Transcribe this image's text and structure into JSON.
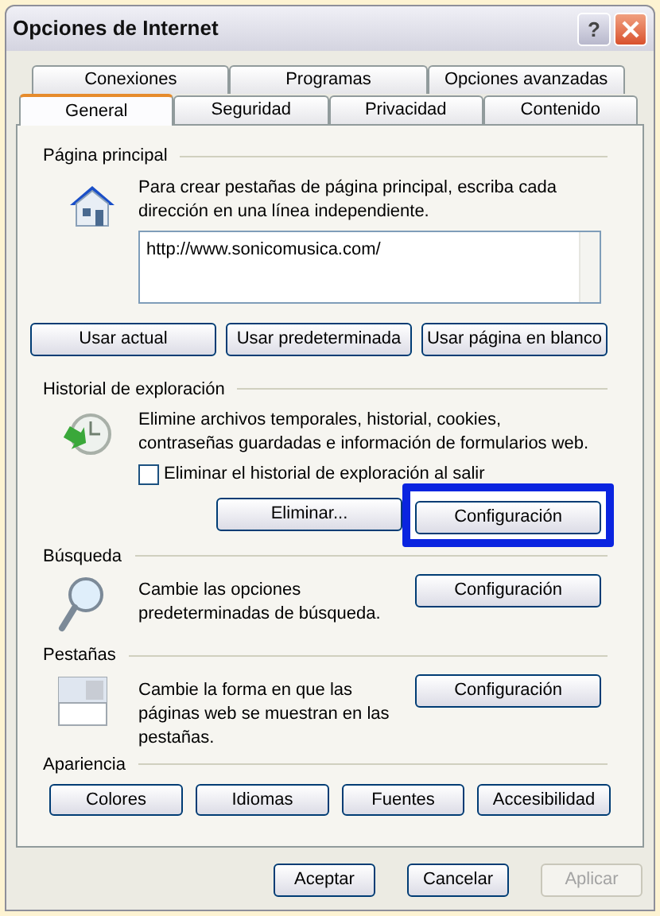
{
  "window": {
    "title": "Opciones de Internet",
    "help": "?"
  },
  "tab_rows": [
    [
      {
        "label": "Conexiones",
        "selected": false
      },
      {
        "label": "Programas",
        "selected": false
      },
      {
        "label": "Opciones avanzadas",
        "selected": false
      }
    ],
    [
      {
        "label": "General",
        "selected": true
      },
      {
        "label": "Seguridad",
        "selected": false
      },
      {
        "label": "Privacidad",
        "selected": false
      },
      {
        "label": "Contenido",
        "selected": false
      }
    ]
  ],
  "sections": [
    {
      "kind": "home",
      "title": "Página principal",
      "description": "Para crear pestañas de página principal, escriba cada dirección en una línea independiente.",
      "url": "http://www.sonicomusica.com/",
      "buttons": [
        {
          "label": "Usar actual",
          "highlighted": false
        },
        {
          "label": "Usar predeterminada",
          "highlighted": false
        },
        {
          "label": "Usar página en blanco",
          "highlighted": false
        }
      ]
    },
    {
      "kind": "history",
      "title": "Historial de exploración",
      "description": "Elimine archivos temporales, historial, cookies, contraseñas guardadas e información de formularios web.",
      "checkbox": {
        "label": "Eliminar el historial de exploración al salir",
        "checked": false
      },
      "buttons": [
        {
          "label": "Eliminar...",
          "highlighted": false
        },
        {
          "label": "Configuración",
          "highlighted": true
        }
      ]
    },
    {
      "kind": "search",
      "title": "Búsqueda",
      "description": "Cambie las opciones predeterminadas de búsqueda.",
      "buttons": [
        {
          "label": "Configuración",
          "highlighted": false
        }
      ]
    },
    {
      "kind": "tabs",
      "title": "Pestañas",
      "description": "Cambie la forma en que las páginas web se muestran en las pestañas.",
      "buttons": [
        {
          "label": "Configuración",
          "highlighted": false
        }
      ]
    },
    {
      "kind": "appearance",
      "title": "Apariencia",
      "buttons": [
        {
          "label": "Colores",
          "highlighted": false
        },
        {
          "label": "Idiomas",
          "highlighted": false
        },
        {
          "label": "Fuentes",
          "highlighted": false
        },
        {
          "label": "Accesibilidad",
          "highlighted": false
        }
      ]
    }
  ],
  "footer_buttons": [
    {
      "label": "Aceptar",
      "disabled": false
    },
    {
      "label": "Cancelar",
      "disabled": false
    },
    {
      "label": "Aplicar",
      "disabled": true
    }
  ]
}
